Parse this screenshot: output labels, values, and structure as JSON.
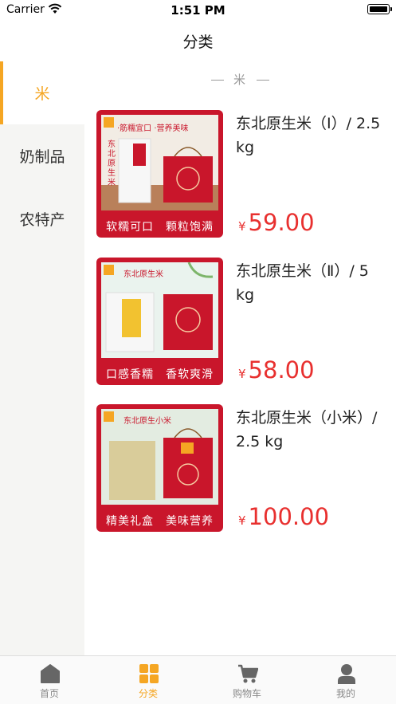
{
  "status_bar": {
    "carrier": "Carrier",
    "time": "1:51 PM"
  },
  "nav": {
    "title": "分类"
  },
  "sidebar": {
    "items": [
      {
        "label": "米",
        "active": true
      },
      {
        "label": "奶制品",
        "active": false
      },
      {
        "label": "农特产",
        "active": false
      }
    ]
  },
  "section": {
    "title": "米"
  },
  "products": [
    {
      "name": "东北原生米（Ⅰ）/ 2.5 kg",
      "currency": "¥",
      "price": "59.00",
      "caption": "软糯可口　颗粒饱满",
      "tagline": "·筋糯宜口 ·营养美味",
      "pack_text": "东北原生米"
    },
    {
      "name": "东北原生米（Ⅱ）/ 5 kg",
      "currency": "¥",
      "price": "58.00",
      "caption": "口感香糯　香软爽滑",
      "tagline": "东北原生米"
    },
    {
      "name": "东北原生米（小米）/ 2.5 kg",
      "currency": "¥",
      "price": "100.00",
      "caption": "精美礼盒　美味营养",
      "tagline": "东北原生小米"
    }
  ],
  "tab_bar": {
    "tabs": [
      {
        "label": "首页",
        "icon": "home-icon"
      },
      {
        "label": "分类",
        "icon": "category-icon"
      },
      {
        "label": "购物车",
        "icon": "cart-icon"
      },
      {
        "label": "我的",
        "icon": "profile-icon"
      }
    ]
  },
  "colors": {
    "accent": "#f5a623",
    "price": "#e8302f",
    "brand_red": "#c9162b"
  }
}
